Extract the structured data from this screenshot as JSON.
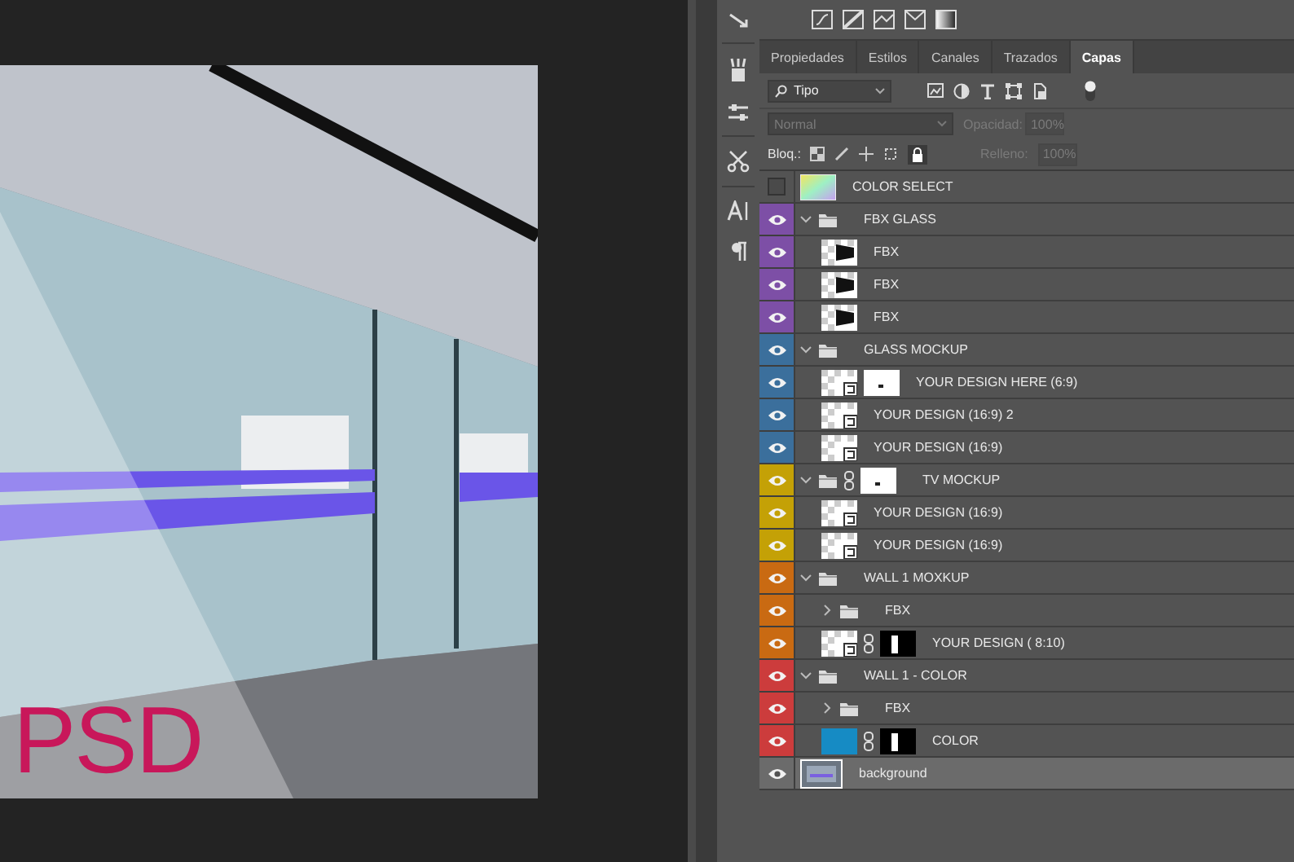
{
  "canvas": {
    "badge": "PSD"
  },
  "panel_tabs": [
    {
      "label": "Propiedades",
      "selected": false
    },
    {
      "label": "Estilos",
      "selected": false
    },
    {
      "label": "Canales",
      "selected": false
    },
    {
      "label": "Trazados",
      "selected": false
    },
    {
      "label": "Capas",
      "selected": true
    }
  ],
  "filter": {
    "value": "Tipo"
  },
  "blend": {
    "mode": "Normal",
    "opacity_label": "Opacidad:",
    "opacity": "100%",
    "disabled": true
  },
  "lock": {
    "label": "Bloq.:",
    "fill_label": "Relleno:",
    "fill": "100%",
    "disabled": true
  },
  "layers": [
    {
      "kind": "gradient",
      "name": "COLOR SELECT",
      "visible": false,
      "selected": false
    },
    {
      "kind": "group",
      "name": "FBX  GLASS",
      "visible": true,
      "selected": false,
      "expanded": true,
      "color": "#7d4fa6",
      "children": [
        {
          "kind": "fbx",
          "name": "FBX",
          "visible": true,
          "selected": false,
          "color": "#7d4fa6"
        },
        {
          "kind": "fbx",
          "name": "FBX",
          "visible": true,
          "selected": false,
          "color": "#7d4fa6"
        },
        {
          "kind": "fbx",
          "name": "FBX",
          "visible": true,
          "selected": false,
          "color": "#7d4fa6"
        }
      ]
    },
    {
      "kind": "group",
      "name": "GLASS MOCKUP",
      "visible": true,
      "selected": false,
      "expanded": true,
      "color": "#3b6f9c",
      "children": [
        {
          "kind": "smart",
          "name": "YOUR DESIGN HERE (6:9)",
          "visible": true,
          "selected": false,
          "mask": {
            "kind": "light"
          },
          "linked": false,
          "color": "#3b6f9c"
        },
        {
          "kind": "smart",
          "name": "YOUR DESIGN (16:9) 2",
          "visible": true,
          "selected": false,
          "color": "#3b6f9c"
        },
        {
          "kind": "smart",
          "name": "YOUR DESIGN (16:9)",
          "visible": true,
          "selected": false,
          "color": "#3b6f9c"
        }
      ]
    },
    {
      "kind": "group",
      "name": "TV MOCKUP",
      "visible": true,
      "selected": false,
      "expanded": true,
      "mask": {
        "kind": "light"
      },
      "linked": true,
      "color": "#c4a106",
      "children": [
        {
          "kind": "smart",
          "name": "YOUR DESIGN (16:9)",
          "visible": true,
          "selected": false,
          "color": "#c4a106"
        },
        {
          "kind": "smart",
          "name": "YOUR DESIGN (16:9)",
          "visible": true,
          "selected": false,
          "color": "#c4a106"
        }
      ]
    },
    {
      "kind": "group",
      "name": "WALL 1 MOXKUP",
      "visible": true,
      "selected": false,
      "expanded": true,
      "color": "#c96a12",
      "children": [
        {
          "kind": "group",
          "name": "FBX",
          "visible": true,
          "selected": false,
          "expanded": false,
          "color": "#c96a12"
        },
        {
          "kind": "smart",
          "name": "YOUR DESIGN ( 8:10)",
          "visible": true,
          "selected": false,
          "mask": {
            "kind": "dark"
          },
          "linked": true,
          "color": "#c96a12"
        }
      ]
    },
    {
      "kind": "group",
      "name": "WALL 1 - COLOR",
      "visible": true,
      "selected": false,
      "expanded": true,
      "color": "#cc3c3c",
      "children": [
        {
          "kind": "group",
          "name": "FBX",
          "visible": true,
          "selected": false,
          "expanded": false,
          "color": "#cc3c3c"
        },
        {
          "kind": "fill",
          "name": "COLOR",
          "visible": true,
          "selected": false,
          "mask": {
            "kind": "dark"
          },
          "linked": true,
          "color": "#cc3c3c"
        }
      ]
    },
    {
      "kind": "image",
      "name": "background",
      "visible": true,
      "selected": true
    }
  ]
}
